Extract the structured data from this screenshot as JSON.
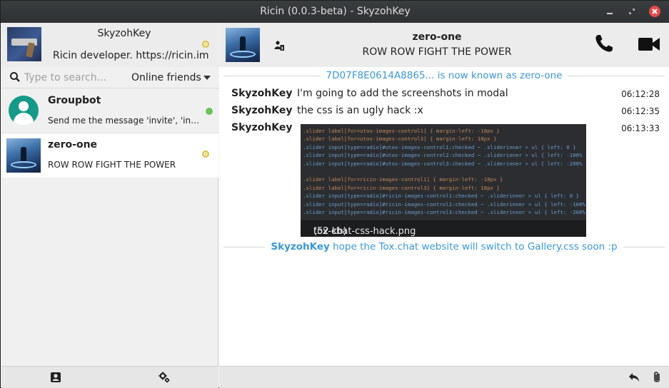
{
  "window": {
    "title": "Ricin (0.0.3-beta) - SkyzohKey",
    "controls": [
      "minimize-icon",
      "restore-icon",
      "close-icon"
    ]
  },
  "profile": {
    "name": "SkyzohKey",
    "status_message": "Ricin developer. https://ricin.im",
    "presence": "away"
  },
  "search": {
    "placeholder": "Type to search...",
    "value": "",
    "filter_selected": "Online friends"
  },
  "contacts": [
    {
      "name": "Groupbot",
      "status": "Send me the message 'invite', 'info', 'help' or a name",
      "presence": "online",
      "avatar": "default-user-avatar"
    },
    {
      "name": "zero-one",
      "status": "ROW ROW FIGHT THE POWER",
      "presence": "away",
      "avatar": "image-avatar",
      "selected": true
    }
  ],
  "chat": {
    "contact_name": "zero-one",
    "contact_status": "ROW ROW FIGHT THE POWER",
    "header_icons": [
      "contact-info-icon",
      "phone-icon",
      "video-call-icon"
    ],
    "system_notice": "7D07F8E0614A8865... is now known as zero-one",
    "messages": [
      {
        "author": "SkyzohKey",
        "text": "I'm going to add the screenshots in modal",
        "time": "06:12:28"
      },
      {
        "author": "SkyzohKey",
        "text": "the css is an ugly hack :x",
        "time": "06:12:35"
      },
      {
        "author": "SkyzohKey",
        "text": "",
        "time": "06:13:33"
      }
    ],
    "attachment": {
      "filename": "tox-chat-css-hack.png",
      "size": "(52 kb)",
      "code_lines": [
        ".slider label[for=utox-images-control1] { margin-left: -18px }",
        ".slider label[for=utox-images-control3] { margin-left: 18px }",
        ".slider input[type=radio]#utox-images-control1:checked ~ .sliderinner > ul { left: 0 }",
        ".slider input[type=radio]#utox-images-control2:checked ~ .sliderinner > ul { left: -100% }",
        ".slider input[type=radio]#utox-images-control3:checked ~ .sliderinner > ul { left: -200% }",
        "",
        ".slider label[for=ricin-images-control1] { margin-left: -18px }",
        ".slider label[for=ricin-images-control3] { margin-left: 18px }",
        ".slider input[type=radio]#ricin-images-control1:checked ~ .sliderinner > ul { left: 0 }",
        ".slider input[type=radio]#ricin-images-control2:checked ~ .sliderinner > ul { left: -100% }",
        ".slider input[type=radio]#ricin-images-control3:checked ~ .sliderinner > ul { left: -200% }"
      ]
    },
    "action_notice": {
      "author": "SkyzohKey",
      "text": "hope the Tox.chat website will switch to Gallery.css soon :p"
    }
  },
  "bottom_left_icons": [
    "add-contact-icon",
    "settings-icon"
  ],
  "bottom_right_icons": [
    "quote-reply-icon",
    "attach-file-icon"
  ],
  "colors": {
    "accent": "#3a98d6",
    "online": "#6ac259",
    "away": "#d9c34a",
    "close_button": "#e24b4b"
  }
}
